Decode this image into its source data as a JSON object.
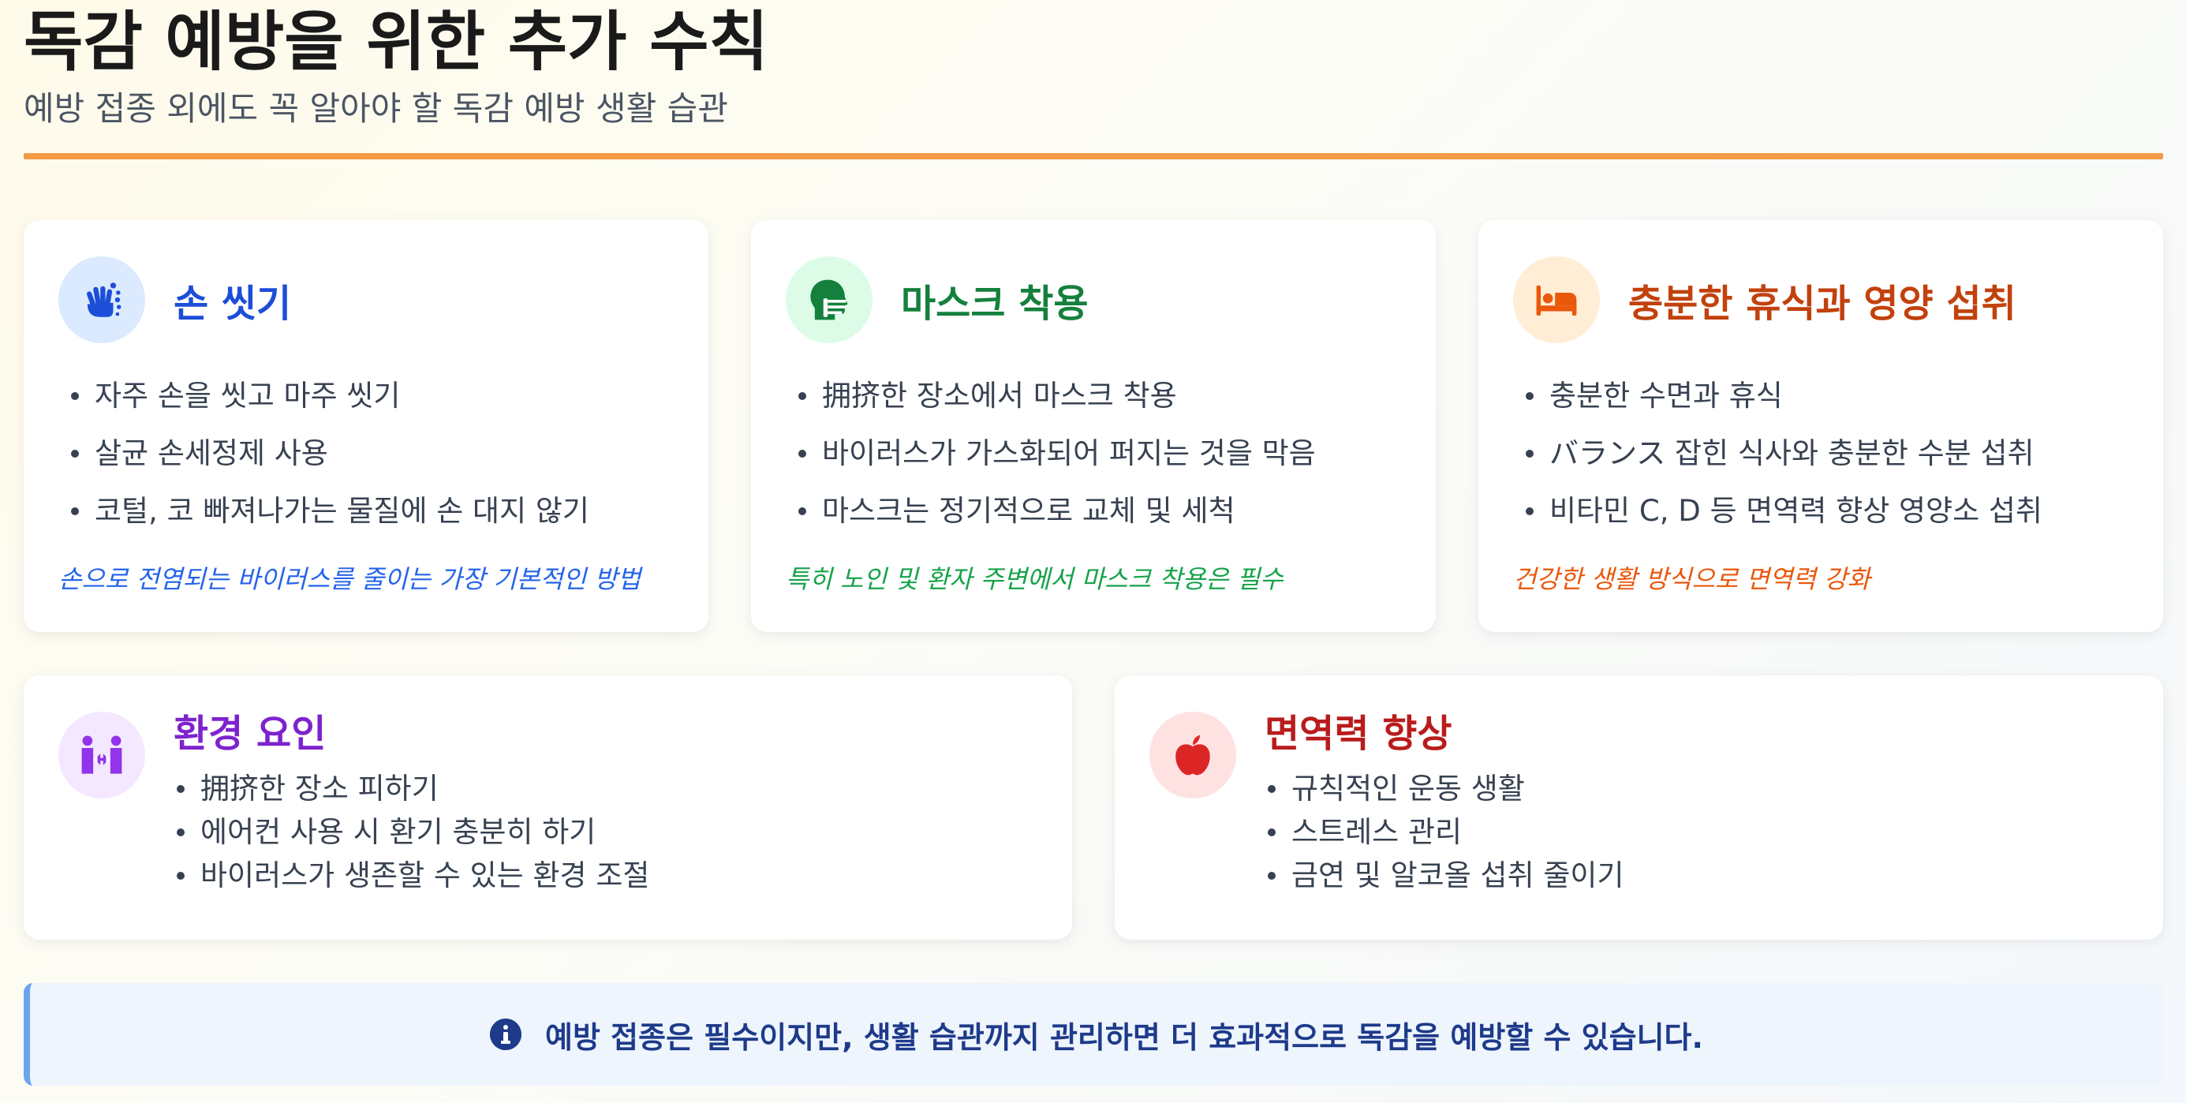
{
  "header": {
    "title": "독감 예방을 위한 추가 수칙",
    "subtitle": "예방 접종 외에도 꼭 알아야 할 독감 예방 생활 습관"
  },
  "cards": [
    {
      "title": "손 씻기",
      "icon": "hands-washing-icon",
      "accent": "#1d4ed8",
      "icon_bg": "#dbeafe",
      "bullets": [
        "자주 손을 씻고 마주 씻기",
        "살균 손세정제 사용",
        "코털, 코 빠져나가는 물질에 손 대지 않기"
      ],
      "note": "손으로 전염되는 바이러스를 줄이는 가장 기본적인 방법",
      "note_color": "#2563eb"
    },
    {
      "title": "마스크 착용",
      "icon": "head-mask-icon",
      "accent": "#15803d",
      "icon_bg": "#dcfce7",
      "bullets": [
        "拥挤한 장소에서 마스크 착용",
        "바이러스가 가스화되어 퍼지는 것을 막음",
        "마스크는 정기적으로 교체 및 세척"
      ],
      "note": "특히 노인 및 환자 주변에서 마스크 착용은 필수",
      "note_color": "#16a34a"
    },
    {
      "title": "충분한 휴식과 영양 섭취",
      "icon": "bed-icon",
      "accent": "#c2410c",
      "icon_bg": "#ffedd5",
      "bullets": [
        "충분한 수면과 휴식",
        "バランス 잡힌 식사와 충분한 수분 섭취",
        "비타민 C, D 등 면역력 향상 영양소 섭취"
      ],
      "note": "건강한 생활 방식으로 면역력 강화",
      "note_color": "#ea580c"
    },
    {
      "title": "환경 요인",
      "icon": "people-arrows-icon",
      "accent": "#7e22ce",
      "icon_bg": "#f3e8ff",
      "bullets": [
        "拥挤한 장소 피하기",
        "에어컨 사용 시 환기 충분히 하기",
        "바이러스가 생존할 수 있는 환경 조절"
      ]
    },
    {
      "title": "면역력 향상",
      "icon": "apple-icon",
      "accent": "#b91c1c",
      "icon_bg": "#fee2e2",
      "bullets": [
        "규칙적인 운동 생활",
        "스트레스 관리",
        "금연 및 알코올 섭취 줄이기"
      ]
    }
  ],
  "banner": {
    "icon": "info-circle-icon",
    "text": "예방 접종은 필수이지만, 생활 습관까지 관리하면 더 효과적으로 독감을 예방할 수 있습니다."
  }
}
